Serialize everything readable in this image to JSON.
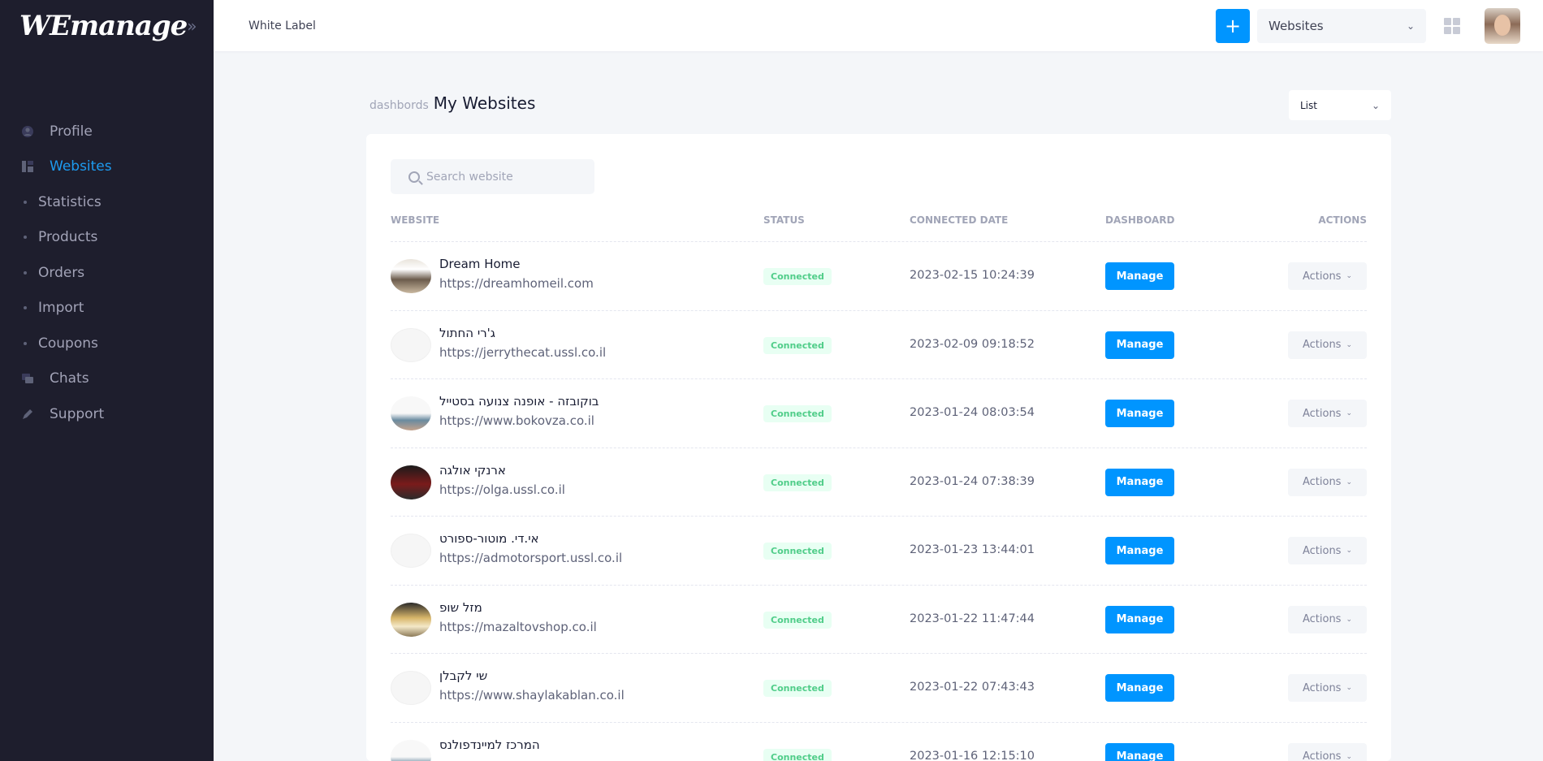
{
  "app": {
    "logo": "WEmanage",
    "header_title": "White Label",
    "plus_label": "+",
    "site_select": "Websites",
    "accent": "#0095ff"
  },
  "sidebar": {
    "items": [
      {
        "label": "Profile",
        "icon": "user-icon"
      },
      {
        "label": "Websites",
        "icon": "websites-icon",
        "active": true
      },
      {
        "label": "Statistics",
        "icon": "bullet"
      },
      {
        "label": "Products",
        "icon": "bullet"
      },
      {
        "label": "Orders",
        "icon": "bullet"
      },
      {
        "label": "Import",
        "icon": "bullet"
      },
      {
        "label": "Coupons",
        "icon": "bullet"
      },
      {
        "label": "Chats",
        "icon": "chat-icon"
      },
      {
        "label": "Support",
        "icon": "pen-icon"
      }
    ]
  },
  "page": {
    "crumb": "dashbords",
    "title": "My Websites",
    "view": "List",
    "search_placeholder": "Search website"
  },
  "table": {
    "headers": {
      "website": "WEBSITE",
      "status": "STATUS",
      "date": "CONNECTED DATE",
      "dashboard": "DASHBOARD",
      "actions": "ACTIONS"
    },
    "manage_label": "Manage",
    "actions_label": "Actions",
    "rows": [
      {
        "name": "Dream Home",
        "url": "https://dreamhomeil.com",
        "status": "Connected",
        "date": "2023-02-15 10:24:39",
        "thumb": "photo"
      },
      {
        "name": "ג'רי החתול",
        "url": "https://jerrythecat.ussl.co.il",
        "status": "Connected",
        "date": "2023-02-09 09:18:52",
        "thumb": "light"
      },
      {
        "name": "בוקובזה - אופנה צנועה בסטייל",
        "url": "https://www.bokovza.co.il",
        "status": "Connected",
        "date": "2023-01-24 08:03:54",
        "thumb": "mixed"
      },
      {
        "name": "ארנקי אולגה",
        "url": "https://olga.ussl.co.il",
        "status": "Connected",
        "date": "2023-01-24 07:38:39",
        "thumb": "dark"
      },
      {
        "name": "אי.די. מוטור-ספורט",
        "url": "https://admotorsport.ussl.co.il",
        "status": "Connected",
        "date": "2023-01-23 13:44:01",
        "thumb": "light"
      },
      {
        "name": "מזל שופ",
        "url": "https://mazaltovshop.co.il",
        "status": "Connected",
        "date": "2023-01-22 11:47:44",
        "thumb": "gold"
      },
      {
        "name": "שי לקבלן",
        "url": "https://www.shaylakablan.co.il",
        "status": "Connected",
        "date": "2023-01-22 07:43:43",
        "thumb": "light"
      },
      {
        "name": "המרכז למיינדפולנס",
        "url": "",
        "status": "Connected",
        "date": "2023-01-16 12:15:10",
        "thumb": "mixed"
      }
    ]
  }
}
